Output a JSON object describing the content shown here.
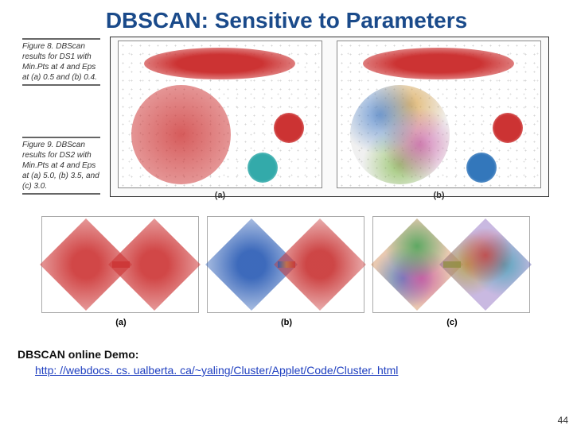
{
  "title": "DBSCAN: Sensitive to Parameters",
  "figure8": {
    "caption": "Figure 8. DBScan results for DS1 with Min.Pts at 4 and Eps at (a) 0.5 and (b) 0.4.",
    "panels": {
      "a": "(a)",
      "b": "(b)"
    }
  },
  "figure9": {
    "caption": "Figure 9. DBScan results for DS2 with Min.Pts at 4 and Eps at (a) 5.0, (b) 3.5, and (c) 3.0.",
    "panels": {
      "a": "(a)",
      "b": "(b)",
      "c": "(c)"
    }
  },
  "demo_label": "DBSCAN online Demo:",
  "demo_url": "http: //webdocs. cs. ualberta. ca/~yaling/Cluster/Applet/Code/Cluster. html",
  "page_number": "44"
}
